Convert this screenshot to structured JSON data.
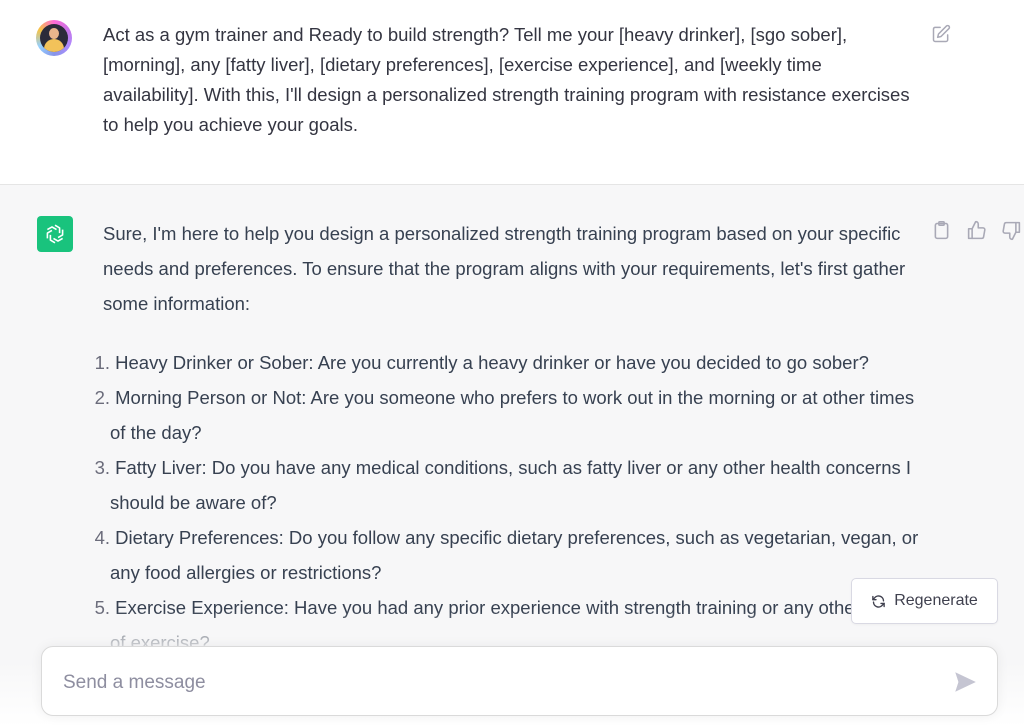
{
  "user_message": {
    "avatar": "user-avatar",
    "text": "Act as a gym trainer and Ready to build strength? Tell me your [heavy drinker], [sgo sober], [morning], any [fatty liver], [dietary preferences], [exercise experience], and [weekly time availability]. With this, I'll design a personalized strength training program with resistance exercises to help you achieve your goals.",
    "edit_icon": "edit-icon"
  },
  "assistant_message": {
    "avatar": "openai-logo-icon",
    "intro": "Sure, I'm here to help you design a personalized strength training program based on your specific needs and preferences. To ensure that the program aligns with your requirements, let's first gather some information:",
    "items": [
      {
        "num": "1.",
        "text": "Heavy Drinker or Sober: Are you currently a heavy drinker or have you decided to go sober?"
      },
      {
        "num": "2.",
        "text": "Morning Person or Not: Are you someone who prefers to work out in the morning or at other times of the day?"
      },
      {
        "num": "3.",
        "text": "Fatty Liver: Do you have any medical conditions, such as fatty liver or any other health concerns I should be aware of?"
      },
      {
        "num": "4.",
        "text": "Dietary Preferences: Do you follow any specific dietary preferences, such as vegetarian, vegan, or any food allergies or restrictions?"
      },
      {
        "num": "5.",
        "text": "Exercise Experience: Have you had any prior experience with strength training or any other forms of exercise?"
      }
    ],
    "actions": [
      "clipboard-icon",
      "thumbs-up-icon",
      "thumbs-down-icon"
    ]
  },
  "regenerate": {
    "label": "Regenerate",
    "icon": "refresh-icon"
  },
  "composer": {
    "placeholder": "Send a message",
    "value": "",
    "send_icon": "send-icon"
  },
  "colors": {
    "accent_green": "#19c37d",
    "assistant_bg": "#f7f7f8",
    "text": "#374151",
    "placeholder": "#8e8ea0"
  }
}
